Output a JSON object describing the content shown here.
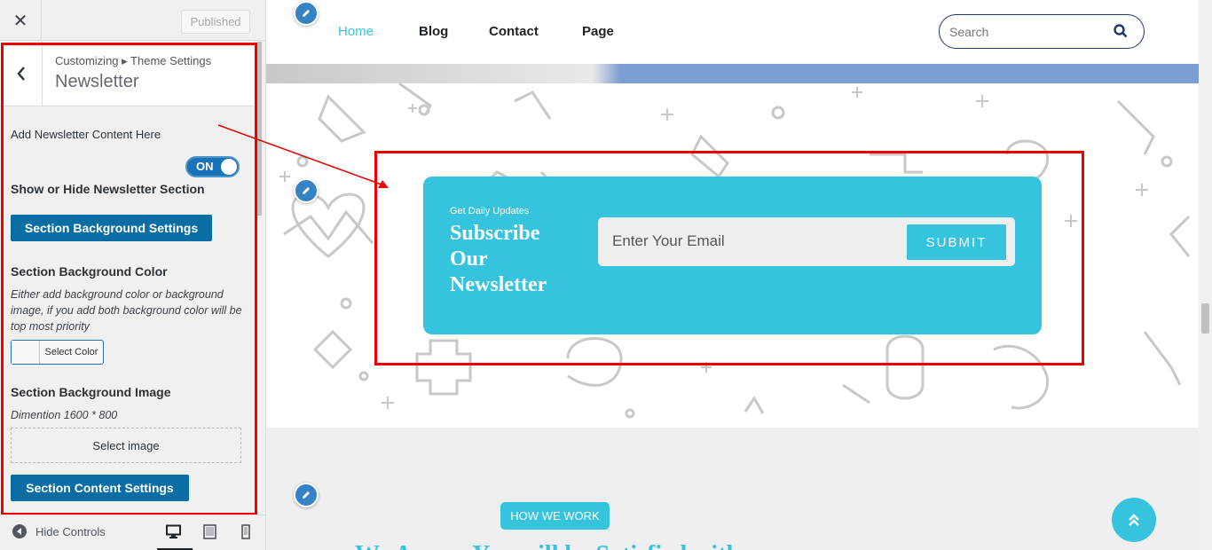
{
  "sidebar": {
    "close_glyph": "✕",
    "publish_label": "Published",
    "breadcrumb": "Customizing ▸ Theme Settings",
    "section_title": "Newsletter",
    "controls": {
      "newsletter_content_label": "Add Newsletter Content Here",
      "toggle_label": "ON",
      "show_hide_title": "Show or Hide Newsletter Section",
      "bg_settings_button": "Section Background Settings",
      "bg_color_title": "Section Background Color",
      "bg_color_desc": "Either add background color or background image, if you add both background color will be top most priority",
      "select_color_label": "Select Color",
      "bg_image_title": "Section Background Image",
      "bg_image_desc": "Dimention 1600 * 800",
      "select_image_label": "Select image",
      "content_settings_button": "Section Content Settings"
    },
    "footer": {
      "hide_controls_label": "Hide Controls"
    }
  },
  "preview": {
    "nav": [
      "Home",
      "Blog",
      "Contact",
      "Page"
    ],
    "search_placeholder": "Search",
    "newsletter": {
      "small_text": "Get Daily Updates",
      "heading": "Subscribe Our Newsletter",
      "email_placeholder": "Enter Your Email",
      "submit_label": "SUBMIT"
    },
    "how_we_work_badge": "HOW WE WORK",
    "work_heading": "We Assure You will be Satisfied with"
  },
  "colors": {
    "accent": "#36c3dd",
    "wp_blue": "#0a6ea4",
    "highlight_red": "#e00000",
    "nav_active": "#36c3dd"
  }
}
